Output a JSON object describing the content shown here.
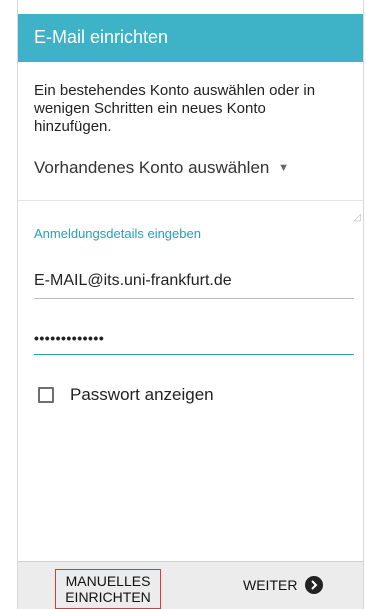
{
  "header": {
    "title": "E-Mail einrichten"
  },
  "intro": {
    "text": "Ein bestehendes Konto auswählen oder in wenigen Schritten ein neues Konto hinzufügen."
  },
  "account_select": {
    "label": "Vorhandenes Konto auswählen"
  },
  "login": {
    "section_label": "Anmeldungsdetails eingeben",
    "email_value": "E-MAIL@its.uni-frankfurt.de",
    "password_value": "•••••••••••••",
    "show_password_label": "Passwort anzeigen"
  },
  "footer": {
    "manual_label_line1": "MANUELLES",
    "manual_label_line2": "EINRICHTEN",
    "next_label": "WEITER"
  },
  "colors": {
    "header": "#3eb2c6",
    "accent": "#2a9fb3",
    "highlight_border": "#d93b3b"
  },
  "icons": {
    "dropdown": "triangle-down-icon",
    "next": "chevron-right-circle-icon"
  }
}
